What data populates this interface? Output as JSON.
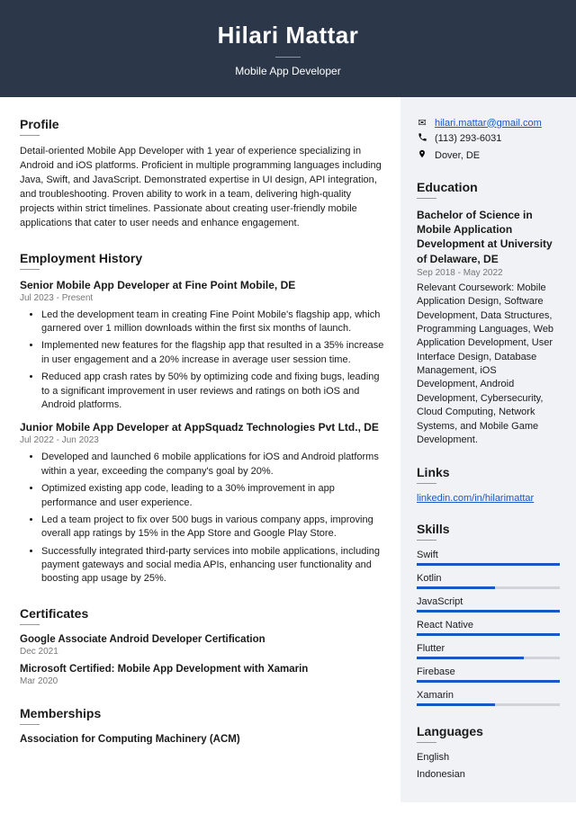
{
  "header": {
    "name": "Hilari Mattar",
    "subtitle": "Mobile App Developer"
  },
  "profile": {
    "title": "Profile",
    "text": "Detail-oriented Mobile App Developer with 1 year of experience specializing in Android and iOS platforms. Proficient in multiple programming languages including Java, Swift, and JavaScript. Demonstrated expertise in UI design, API integration, and troubleshooting. Proven ability to work in a team, delivering high-quality projects within strict timelines. Passionate about creating user-friendly mobile applications that cater to user needs and enhance engagement."
  },
  "employment": {
    "title": "Employment History",
    "jobs": [
      {
        "title": "Senior Mobile App Developer at Fine Point Mobile, DE",
        "dates": "Jul 2023 - Present",
        "bullets": [
          "Led the development team in creating Fine Point Mobile's flagship app, which garnered over 1 million downloads within the first six months of launch.",
          "Implemented new features for the flagship app that resulted in a 35% increase in user engagement and a 20% increase in average user session time.",
          "Reduced app crash rates by 50% by optimizing code and fixing bugs, leading to a significant improvement in user reviews and ratings on both iOS and Android platforms."
        ]
      },
      {
        "title": "Junior Mobile App Developer at AppSquadz Technologies Pvt Ltd., DE",
        "dates": "Jul 2022 - Jun 2023",
        "bullets": [
          "Developed and launched 6 mobile applications for iOS and Android platforms within a year, exceeding the company's goal by 20%.",
          "Optimized existing app code, leading to a 30% improvement in app performance and user experience.",
          "Led a team project to fix over 500 bugs in various company apps, improving overall app ratings by 15% in the App Store and Google Play Store.",
          "Successfully integrated third-party services into mobile applications, including payment gateways and social media APIs, enhancing user functionality and boosting app usage by 25%."
        ]
      }
    ]
  },
  "certificates": {
    "title": "Certificates",
    "items": [
      {
        "title": "Google Associate Android Developer Certification",
        "date": "Dec 2021"
      },
      {
        "title": "Microsoft Certified: Mobile App Development with Xamarin",
        "date": "Mar 2020"
      }
    ]
  },
  "memberships": {
    "title": "Memberships",
    "items": [
      {
        "title": "Association for Computing Machinery (ACM)"
      }
    ]
  },
  "contact": {
    "email": "hilari.mattar@gmail.com",
    "phone": "(113) 293-6031",
    "location": "Dover, DE"
  },
  "education": {
    "title": "Education",
    "degree": "Bachelor of Science in Mobile Application Development at University of Delaware, DE",
    "dates": "Sep 2018 - May 2022",
    "desc": "Relevant Coursework: Mobile Application Design, Software Development, Data Structures, Programming Languages, Web Application Development, User Interface Design, Database Management, iOS Development, Android Development, Cybersecurity, Cloud Computing, Network Systems, and Mobile Game Development."
  },
  "links": {
    "title": "Links",
    "url": "linkedin.com/in/hilarimattar"
  },
  "skills": {
    "title": "Skills",
    "items": [
      {
        "name": "Swift",
        "level": 100
      },
      {
        "name": "Kotlin",
        "level": 55
      },
      {
        "name": "JavaScript",
        "level": 100
      },
      {
        "name": "React Native",
        "level": 100
      },
      {
        "name": "Flutter",
        "level": 75
      },
      {
        "name": "Firebase",
        "level": 100
      },
      {
        "name": "Xamarin",
        "level": 55
      }
    ]
  },
  "languages": {
    "title": "Languages",
    "items": [
      "English",
      "Indonesian"
    ]
  }
}
